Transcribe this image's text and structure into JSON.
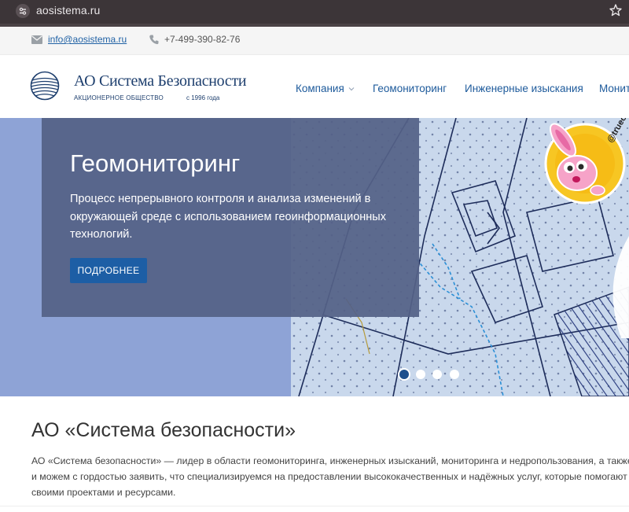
{
  "browser": {
    "url": "aosistema.ru"
  },
  "topbar": {
    "email": "info@aosistema.ru",
    "phone": "+7-499-390-82-76"
  },
  "logo": {
    "title": "АО Система Безопасности",
    "subtitle": "АКЦИОНЕРНОЕ ОБЩЕСТВО",
    "year": "с 1996 года"
  },
  "nav": {
    "items": [
      "Компания",
      "Геомониторинг",
      "Инженерные изыскания",
      "Монит"
    ]
  },
  "hero": {
    "title": "Геомониторинг",
    "description": "Процесс непрерывного контроля и анализа изменений в окружающей среде с использованием геоинформационных технологий.",
    "button": "ПОДРОБНЕЕ",
    "slide_count": 4,
    "active_slide": 1,
    "sticker_handle": "@trueosint"
  },
  "about": {
    "title": "АО «Система безопасности»",
    "text": "АО «Система безопасности» — лидер в области геомониторинга, инженерных изысканий, мониторинга и недропользования, а также\nи можем с гордостью заявить, что специализируемся на предоставлении высококачественных и надёжных услуг, которые помогают н\nсвоими проектами и ресурсами."
  },
  "colors": {
    "link": "#2162a5",
    "button": "#1d5ea5",
    "hero_bg": "#8ea3d6",
    "panel": "#546186"
  }
}
